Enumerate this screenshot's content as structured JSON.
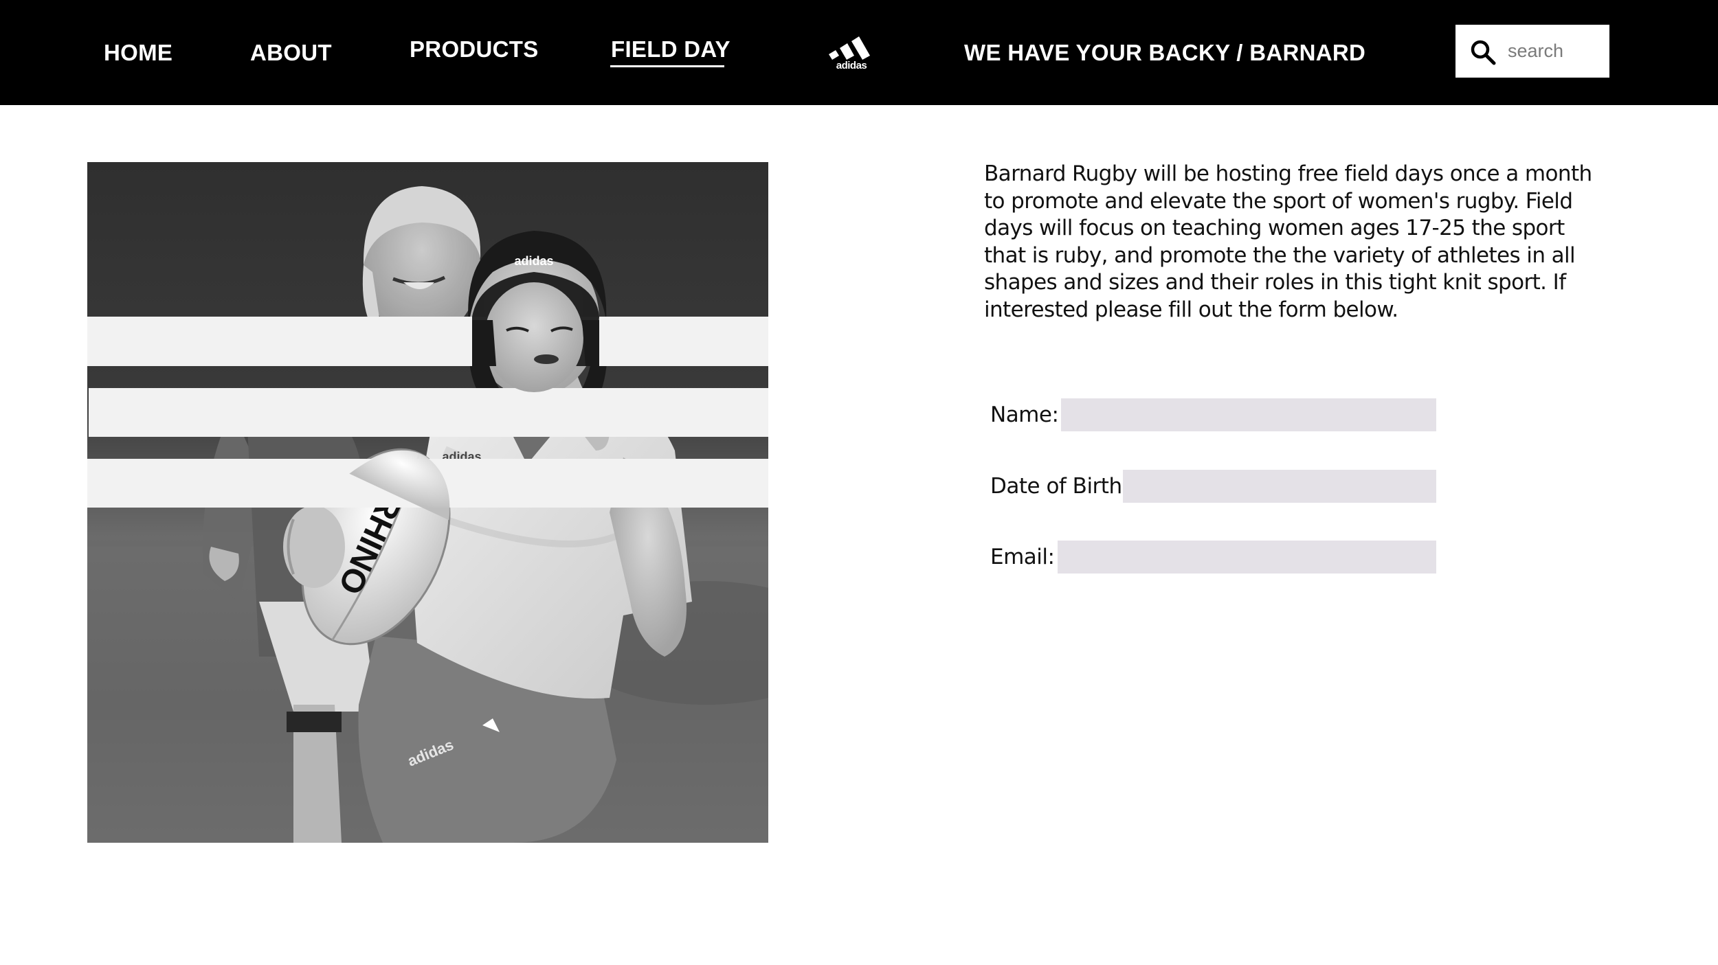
{
  "nav": {
    "items": [
      {
        "label": "HOME"
      },
      {
        "label": "ABOUT"
      },
      {
        "label": "PRODUCTS"
      },
      {
        "label": "FIELD DAY",
        "active": true
      }
    ],
    "logo": {
      "icon": "adidas-logo-icon",
      "text": "adidas"
    },
    "tagline": "WE HAVE YOUR BACKY / BARNARD",
    "search": {
      "placeholder": "search",
      "value": "",
      "icon": "search-icon"
    }
  },
  "hero": {
    "description": "black-and-white photo of women's rugby player running with ball, overlaid with three horizontal white stripes",
    "ball_text": "RHINO"
  },
  "content": {
    "intro": "Barnard Rugby will be hosting free field days once a month to promote and elevate the sport of women's rugby. Field days will focus on teaching women ages 17-25 the sport that is ruby, and promote the the variety of athletes in all shapes and sizes and their roles in this tight knit sport. If interested please fill out the form below."
  },
  "form": {
    "fields": [
      {
        "label": "Name:",
        "value": ""
      },
      {
        "label": "Date of Birth:",
        "value": ""
      },
      {
        "label": "Email:",
        "value": ""
      }
    ]
  },
  "colors": {
    "nav_bg": "#000000",
    "nav_text": "#ffffff",
    "field_bg": "#e4e1e7",
    "stripe": "#f2f2f2"
  }
}
